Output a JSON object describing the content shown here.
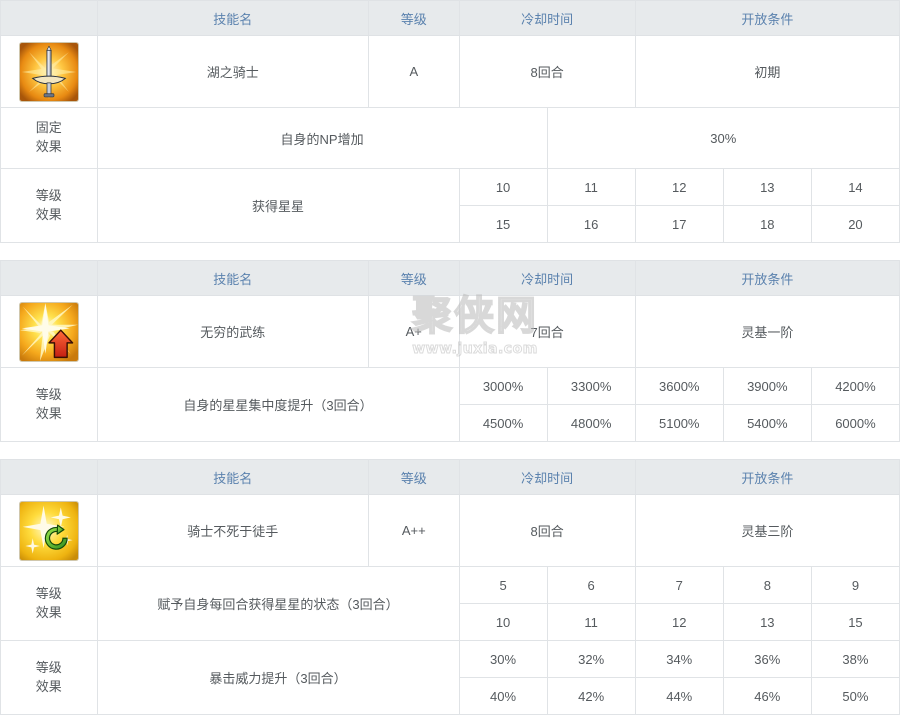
{
  "colors": {
    "header_bg": "#e7eaec",
    "header_text": "#5b82ae",
    "border": "#e0e3e6",
    "body_text": "#4f5358",
    "watermark": "#b9b9b9"
  },
  "watermark": {
    "brand": "聚侠网",
    "url": "www.juxia.com"
  },
  "columns": {
    "name": "技能名",
    "rank": "等级",
    "cooldown": "冷却时间",
    "unlock": "开放条件"
  },
  "labels": {
    "fixed_effect": {
      "line1": "固定",
      "line2": "效果"
    },
    "level_effect": {
      "line1": "等级",
      "line2": "效果"
    }
  },
  "skills": [
    {
      "icon": "sword-skill-icon",
      "name": "湖之骑士",
      "rank": "A",
      "cooldown": "8回合",
      "unlock": "初期",
      "effects": [
        {
          "kind": "fixed",
          "label_line1": "固定",
          "label_line2": "效果",
          "desc": "自身的NP增加",
          "single_value": "30%"
        },
        {
          "kind": "level",
          "label_line1": "等级",
          "label_line2": "效果",
          "desc": "获得星星",
          "rows": [
            [
              "10",
              "11",
              "12",
              "13",
              "14"
            ],
            [
              "15",
              "16",
              "17",
              "18",
              "20"
            ]
          ]
        }
      ]
    },
    {
      "icon": "starburst-up-skill-icon",
      "name": "无穷的武练",
      "rank": "A+",
      "cooldown": "7回合",
      "unlock": "灵基一阶",
      "effects": [
        {
          "kind": "level",
          "label_line1": "等级",
          "label_line2": "效果",
          "desc": "自身的星星集中度提升（3回合）",
          "rows": [
            [
              "3000%",
              "3300%",
              "3600%",
              "3900%",
              "4200%"
            ],
            [
              "4500%",
              "4800%",
              "5100%",
              "5400%",
              "6000%"
            ]
          ]
        }
      ]
    },
    {
      "icon": "stars-refresh-skill-icon",
      "name": "骑士不死于徒手",
      "rank": "A++",
      "cooldown": "8回合",
      "unlock": "灵基三阶",
      "effects": [
        {
          "kind": "level",
          "label_line1": "等级",
          "label_line2": "效果",
          "desc": "赋予自身每回合获得星星的状态（3回合）",
          "rows": [
            [
              "5",
              "6",
              "7",
              "8",
              "9"
            ],
            [
              "10",
              "11",
              "12",
              "13",
              "15"
            ]
          ]
        },
        {
          "kind": "level",
          "label_line1": "等级",
          "label_line2": "效果",
          "desc": "暴击威力提升（3回合）",
          "rows": [
            [
              "30%",
              "32%",
              "34%",
              "36%",
              "38%"
            ],
            [
              "40%",
              "42%",
              "44%",
              "46%",
              "50%"
            ]
          ]
        }
      ]
    }
  ]
}
